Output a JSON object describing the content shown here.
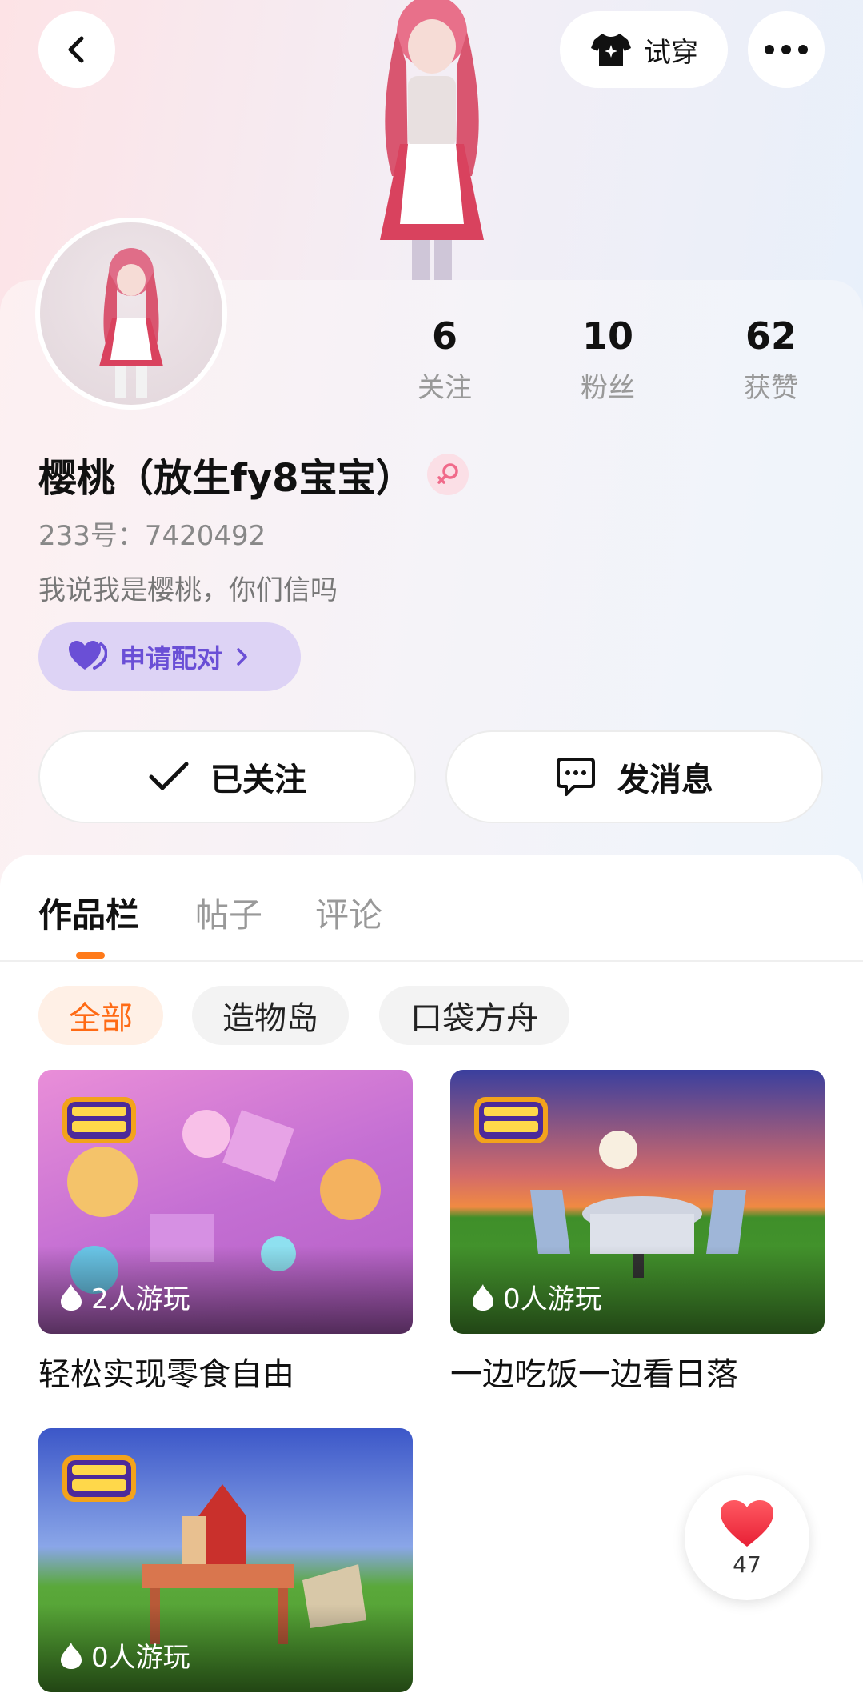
{
  "header": {
    "try_on_label": "试穿"
  },
  "stats": [
    {
      "value": "6",
      "label": "关注"
    },
    {
      "value": "10",
      "label": "粉丝"
    },
    {
      "value": "62",
      "label": "获赞"
    }
  ],
  "profile": {
    "name": "樱桃（放生fy8宝宝）",
    "uid": "233号：7420492",
    "bio": "我说我是樱桃，你们信吗",
    "pair_label": "申请配对"
  },
  "actions": {
    "followed_label": "已关注",
    "message_label": "发消息"
  },
  "tabs": [
    "作品栏",
    "帖子",
    "评论"
  ],
  "filters": [
    "全部",
    "造物岛",
    "口袋方舟"
  ],
  "works": [
    {
      "title": "轻松实现零食自由",
      "plays": "2人游玩"
    },
    {
      "title": "一边吃饭一边看日落",
      "plays": "0人游玩"
    },
    {
      "title": "",
      "plays": "0人游玩"
    }
  ],
  "like_button": {
    "count": "47"
  },
  "colors": {
    "accent": "#ff7a1a",
    "pair_text": "#6a4fd6",
    "pair_bg": "#ddd3f5",
    "like_red": "#f0333f"
  }
}
